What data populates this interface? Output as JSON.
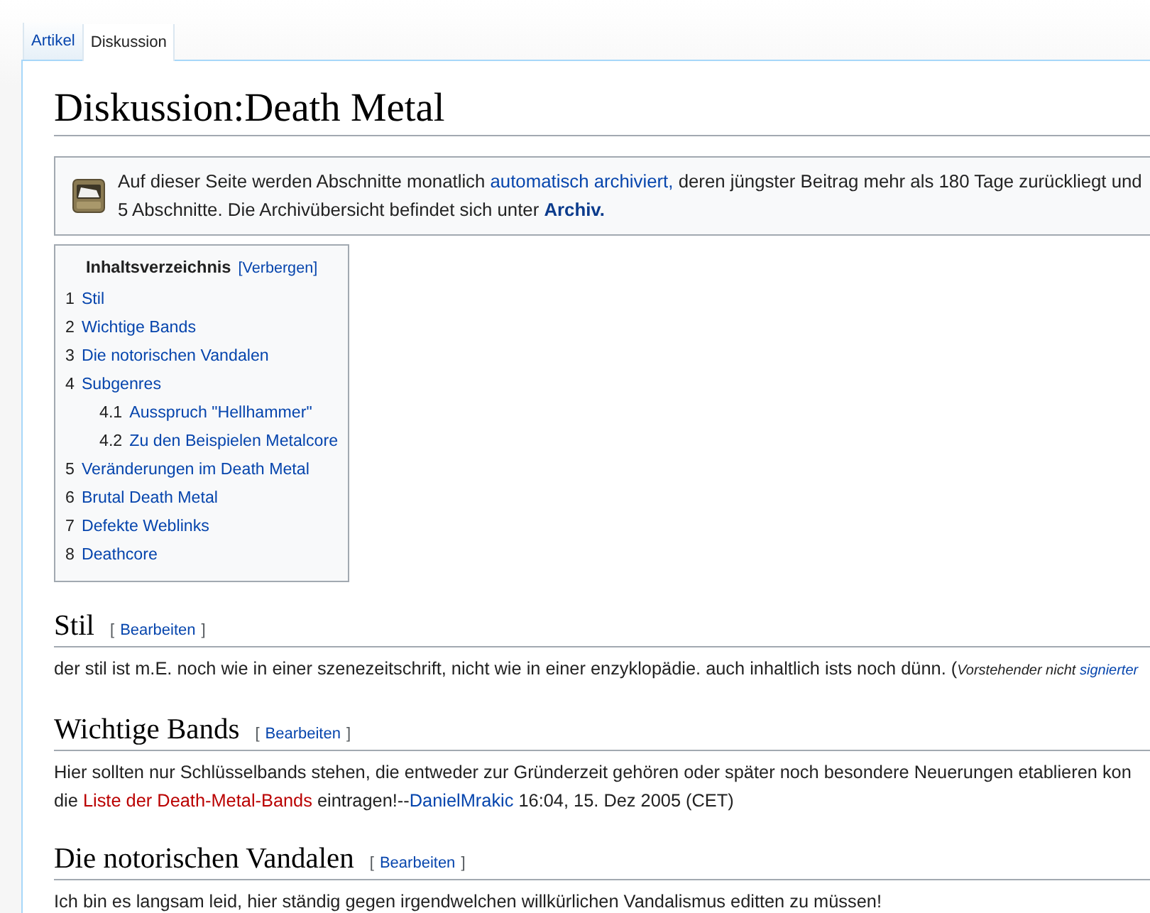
{
  "tabs": [
    {
      "label": "Artikel",
      "selected": false
    },
    {
      "label": "Diskussion",
      "selected": true
    }
  ],
  "page_title": "Diskussion:Death Metal",
  "notice": {
    "lines": [
      [
        {
          "kind": "text",
          "text": "Auf dieser Seite werden Abschnitte monatlich "
        },
        {
          "kind": "link",
          "text": "automatisch archiviert,"
        },
        {
          "kind": "text",
          "text": " deren jüngster Beitrag mehr als 180 Tage zurückliegt und"
        }
      ],
      [
        {
          "kind": "text",
          "text": "5 Abschnitte. Die Archivübersicht befindet sich unter "
        },
        {
          "kind": "link",
          "text": "Archiv.",
          "bold": true
        }
      ]
    ]
  },
  "toc": {
    "title": "Inhaltsverzeichnis",
    "toggle": "[Verbergen]",
    "items": [
      {
        "number": "1",
        "label": "Stil"
      },
      {
        "number": "2",
        "label": "Wichtige Bands"
      },
      {
        "number": "3",
        "label": "Die notorischen Vandalen"
      },
      {
        "number": "4",
        "label": "Subgenres",
        "children": [
          {
            "number": "4.1",
            "label": "Ausspruch \"Hellhammer\""
          },
          {
            "number": "4.2",
            "label": "Zu den Beispielen Metalcore"
          }
        ]
      },
      {
        "number": "5",
        "label": "Veränderungen im Death Metal"
      },
      {
        "number": "6",
        "label": "Brutal Death Metal"
      },
      {
        "number": "7",
        "label": "Defekte Weblinks"
      },
      {
        "number": "8",
        "label": "Deathcore"
      }
    ]
  },
  "sections": [
    {
      "heading": "Stil",
      "edit": {
        "before": "[",
        "label": "Bearbeiten",
        "after": "]"
      },
      "lines": [
        [
          {
            "kind": "text",
            "text": "der stil ist m.E. noch wie in einer szenezeitschrift, nicht wie in einer enzyklopädie. auch inhaltlich ists noch dünn. ("
          },
          {
            "kind": "note",
            "text": "Vorstehender nicht "
          },
          {
            "kind": "note_link",
            "text": "signierter"
          }
        ]
      ]
    },
    {
      "heading": "Wichtige Bands",
      "edit": {
        "before": "[",
        "label": "Bearbeiten",
        "after": "]"
      },
      "lines": [
        [
          {
            "kind": "text",
            "text": "Hier sollten nur Schlüsselbands stehen, die entweder zur Gründerzeit gehören oder später noch besondere Neuerungen etablieren kon"
          }
        ],
        [
          {
            "kind": "text",
            "text": "die "
          },
          {
            "kind": "redlink",
            "text": "Liste der Death-Metal-Bands"
          },
          {
            "kind": "text",
            "text": " eintragen!--"
          },
          {
            "kind": "link",
            "text": "DanielMrakic"
          },
          {
            "kind": "text",
            "text": " 16:04, 15. Dez 2005 (CET)"
          }
        ]
      ]
    },
    {
      "heading": "Die notorischen Vandalen",
      "edit": {
        "before": "[",
        "label": "Bearbeiten",
        "after": "]"
      },
      "lines": [
        [
          {
            "kind": "text",
            "text": "Ich bin es langsam leid, hier ständig gegen irgendwelchen willkürlichen Vandalismus editten zu müssen!"
          }
        ]
      ]
    }
  ]
}
